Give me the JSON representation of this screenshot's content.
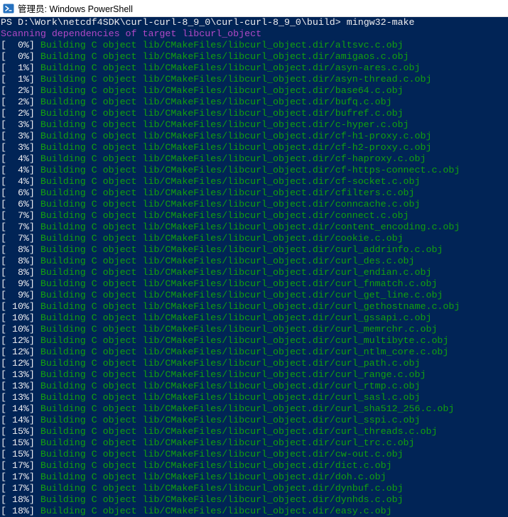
{
  "window": {
    "title": "管理员: Windows PowerShell",
    "app_icon": "powershell-icon",
    "background": "#012456"
  },
  "console": {
    "prompt": "PS D:\\Work\\netcdf4SDK\\curl-curl-8_9_0\\curl-curl-8_9_0\\build> ",
    "command": "mingw32-make",
    "scanning": "Scanning dependencies of target libcurl_object",
    "colors": {
      "default": "#eeedf0",
      "scanning": "#b148c6",
      "building": "#13a10e"
    },
    "build_lines": [
      {
        "pct": "[  0%] ",
        "text": "Building C object lib/CMakeFiles/libcurl_object.dir/altsvc.c.obj"
      },
      {
        "pct": "[  0%] ",
        "text": "Building C object lib/CMakeFiles/libcurl_object.dir/amigaos.c.obj"
      },
      {
        "pct": "[  1%] ",
        "text": "Building C object lib/CMakeFiles/libcurl_object.dir/asyn-ares.c.obj"
      },
      {
        "pct": "[  1%] ",
        "text": "Building C object lib/CMakeFiles/libcurl_object.dir/asyn-thread.c.obj"
      },
      {
        "pct": "[  2%] ",
        "text": "Building C object lib/CMakeFiles/libcurl_object.dir/base64.c.obj"
      },
      {
        "pct": "[  2%] ",
        "text": "Building C object lib/CMakeFiles/libcurl_object.dir/bufq.c.obj"
      },
      {
        "pct": "[  2%] ",
        "text": "Building C object lib/CMakeFiles/libcurl_object.dir/bufref.c.obj"
      },
      {
        "pct": "[  3%] ",
        "text": "Building C object lib/CMakeFiles/libcurl_object.dir/c-hyper.c.obj"
      },
      {
        "pct": "[  3%] ",
        "text": "Building C object lib/CMakeFiles/libcurl_object.dir/cf-h1-proxy.c.obj"
      },
      {
        "pct": "[  3%] ",
        "text": "Building C object lib/CMakeFiles/libcurl_object.dir/cf-h2-proxy.c.obj"
      },
      {
        "pct": "[  4%] ",
        "text": "Building C object lib/CMakeFiles/libcurl_object.dir/cf-haproxy.c.obj"
      },
      {
        "pct": "[  4%] ",
        "text": "Building C object lib/CMakeFiles/libcurl_object.dir/cf-https-connect.c.obj"
      },
      {
        "pct": "[  4%] ",
        "text": "Building C object lib/CMakeFiles/libcurl_object.dir/cf-socket.c.obj"
      },
      {
        "pct": "[  6%] ",
        "text": "Building C object lib/CMakeFiles/libcurl_object.dir/cfilters.c.obj"
      },
      {
        "pct": "[  6%] ",
        "text": "Building C object lib/CMakeFiles/libcurl_object.dir/conncache.c.obj"
      },
      {
        "pct": "[  7%] ",
        "text": "Building C object lib/CMakeFiles/libcurl_object.dir/connect.c.obj"
      },
      {
        "pct": "[  7%] ",
        "text": "Building C object lib/CMakeFiles/libcurl_object.dir/content_encoding.c.obj"
      },
      {
        "pct": "[  7%] ",
        "text": "Building C object lib/CMakeFiles/libcurl_object.dir/cookie.c.obj"
      },
      {
        "pct": "[  8%] ",
        "text": "Building C object lib/CMakeFiles/libcurl_object.dir/curl_addrinfo.c.obj"
      },
      {
        "pct": "[  8%] ",
        "text": "Building C object lib/CMakeFiles/libcurl_object.dir/curl_des.c.obj"
      },
      {
        "pct": "[  8%] ",
        "text": "Building C object lib/CMakeFiles/libcurl_object.dir/curl_endian.c.obj"
      },
      {
        "pct": "[  9%] ",
        "text": "Building C object lib/CMakeFiles/libcurl_object.dir/curl_fnmatch.c.obj"
      },
      {
        "pct": "[  9%] ",
        "text": "Building C object lib/CMakeFiles/libcurl_object.dir/curl_get_line.c.obj"
      },
      {
        "pct": "[ 10%] ",
        "text": "Building C object lib/CMakeFiles/libcurl_object.dir/curl_gethostname.c.obj"
      },
      {
        "pct": "[ 10%] ",
        "text": "Building C object lib/CMakeFiles/libcurl_object.dir/curl_gssapi.c.obj"
      },
      {
        "pct": "[ 10%] ",
        "text": "Building C object lib/CMakeFiles/libcurl_object.dir/curl_memrchr.c.obj"
      },
      {
        "pct": "[ 12%] ",
        "text": "Building C object lib/CMakeFiles/libcurl_object.dir/curl_multibyte.c.obj"
      },
      {
        "pct": "[ 12%] ",
        "text": "Building C object lib/CMakeFiles/libcurl_object.dir/curl_ntlm_core.c.obj"
      },
      {
        "pct": "[ 12%] ",
        "text": "Building C object lib/CMakeFiles/libcurl_object.dir/curl_path.c.obj"
      },
      {
        "pct": "[ 13%] ",
        "text": "Building C object lib/CMakeFiles/libcurl_object.dir/curl_range.c.obj"
      },
      {
        "pct": "[ 13%] ",
        "text": "Building C object lib/CMakeFiles/libcurl_object.dir/curl_rtmp.c.obj"
      },
      {
        "pct": "[ 13%] ",
        "text": "Building C object lib/CMakeFiles/libcurl_object.dir/curl_sasl.c.obj"
      },
      {
        "pct": "[ 14%] ",
        "text": "Building C object lib/CMakeFiles/libcurl_object.dir/curl_sha512_256.c.obj"
      },
      {
        "pct": "[ 14%] ",
        "text": "Building C object lib/CMakeFiles/libcurl_object.dir/curl_sspi.c.obj"
      },
      {
        "pct": "[ 15%] ",
        "text": "Building C object lib/CMakeFiles/libcurl_object.dir/curl_threads.c.obj"
      },
      {
        "pct": "[ 15%] ",
        "text": "Building C object lib/CMakeFiles/libcurl_object.dir/curl_trc.c.obj"
      },
      {
        "pct": "[ 15%] ",
        "text": "Building C object lib/CMakeFiles/libcurl_object.dir/cw-out.c.obj"
      },
      {
        "pct": "[ 17%] ",
        "text": "Building C object lib/CMakeFiles/libcurl_object.dir/dict.c.obj"
      },
      {
        "pct": "[ 17%] ",
        "text": "Building C object lib/CMakeFiles/libcurl_object.dir/doh.c.obj"
      },
      {
        "pct": "[ 17%] ",
        "text": "Building C object lib/CMakeFiles/libcurl_object.dir/dynbuf.c.obj"
      },
      {
        "pct": "[ 18%] ",
        "text": "Building C object lib/CMakeFiles/libcurl_object.dir/dynhds.c.obj"
      },
      {
        "pct": "[ 18%] ",
        "text": "Building C object lib/CMakeFiles/libcurl_object.dir/easy.c.obj"
      }
    ]
  }
}
